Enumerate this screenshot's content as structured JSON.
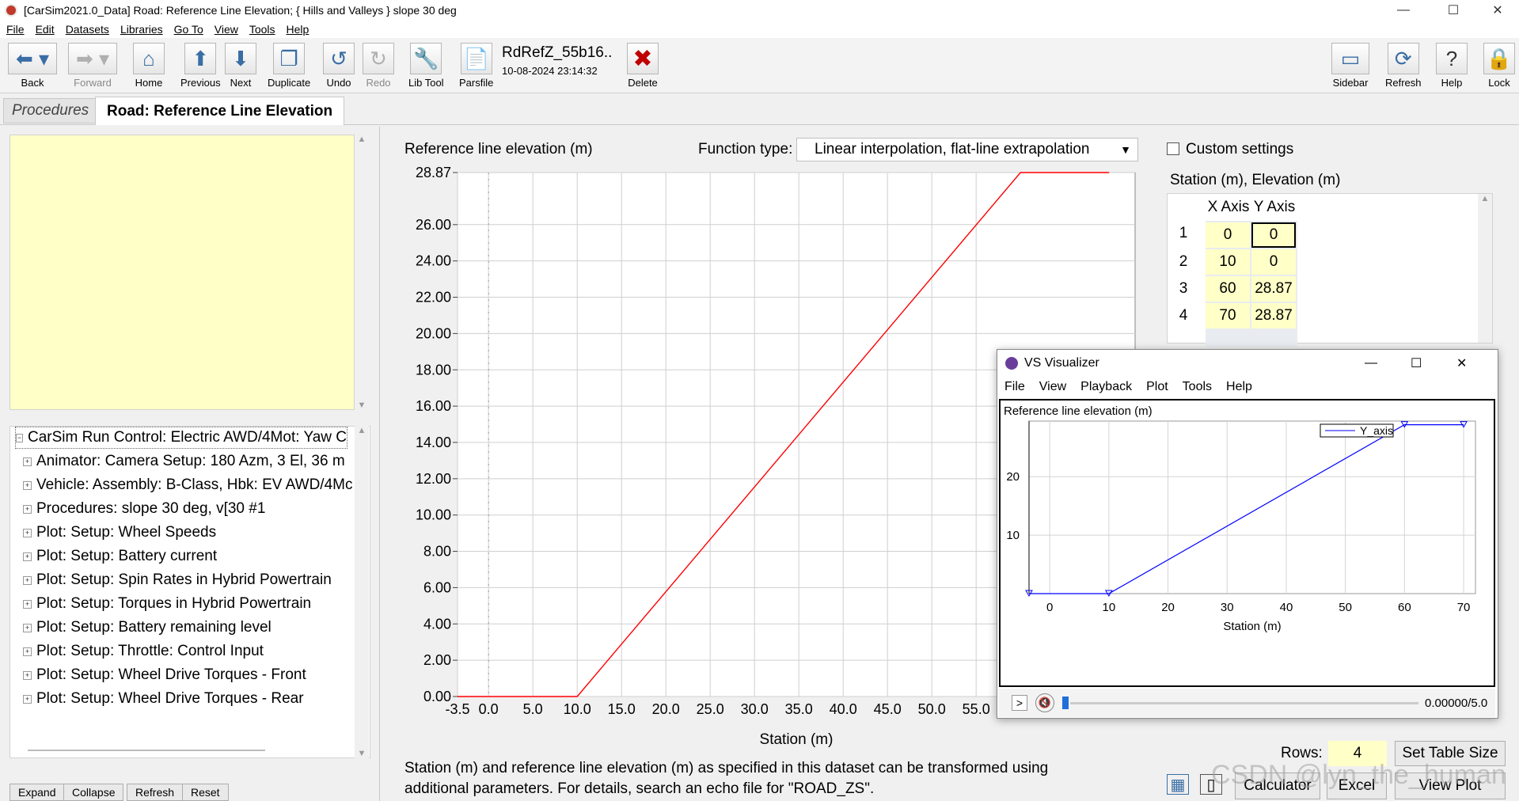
{
  "window": {
    "title": "[CarSim2021.0_Data] Road: Reference Line Elevation; { Hills and Valleys } slope 30 deg"
  },
  "menu": [
    "File",
    "Edit",
    "Datasets",
    "Libraries",
    "Go To",
    "View",
    "Tools",
    "Help"
  ],
  "toolbar": {
    "back": "Back",
    "forward": "Forward",
    "home": "Home",
    "previous": "Previous",
    "next": "Next",
    "duplicate": "Duplicate",
    "undo": "Undo",
    "redo": "Redo",
    "libtool": "Lib Tool",
    "parsfile": "Parsfile",
    "dataset_name": "RdRefZ_55b16..",
    "dataset_date": "10-08-2024 23:14:32",
    "delete": "Delete",
    "sidebar": "Sidebar",
    "refresh": "Refresh",
    "help": "Help",
    "lock": "Lock"
  },
  "tabs": {
    "procedures": "Procedures",
    "current": "Road: Reference Line Elevation"
  },
  "tree": {
    "items": [
      "CarSim Run Control: Electric AWD/4Mot: Yaw C",
      "Animator: Camera Setup: 180 Azm, 3 El, 36 m",
      "Vehicle: Assembly: B-Class, Hbk: EV AWD/4Mc",
      "Procedures: slope 30 deg, v[30 #1",
      "Plot: Setup: Wheel Speeds",
      "Plot: Setup: Battery current",
      "Plot: Setup: Spin Rates in Hybrid Powertrain",
      "Plot: Setup: Torques in Hybrid Powertrain",
      "Plot: Setup: Battery remaining level",
      "Plot: Setup: Throttle: Control Input",
      "Plot: Setup: Wheel Drive Torques - Front",
      "Plot: Setup: Wheel Drive Torques - Rear"
    ],
    "buttons": {
      "expand": "Expand",
      "collapse": "Collapse",
      "refresh": "Refresh",
      "reset": "Reset"
    }
  },
  "main": {
    "plot_title": "Reference line elevation (m)",
    "function_label": "Function type:",
    "function_value": "Linear interpolation, flat-line extrapolation",
    "custom_settings": "Custom settings",
    "table_title": "Station (m), Elevation (m)",
    "table_cols": [
      "X Axis",
      "Y Axis"
    ],
    "table_rows": [
      [
        "1",
        "0",
        "0"
      ],
      [
        "2",
        "10",
        "0"
      ],
      [
        "3",
        "60",
        "28.87"
      ],
      [
        "4",
        "70",
        "28.87"
      ]
    ],
    "description": "Station (m) and reference line elevation (m) as specified in this dataset can be transformed using additional parameters. For details, search an echo file for \"ROAD_ZS\".",
    "rows_label": "Rows:",
    "rows_value": "4",
    "set_table_size": "Set Table Size",
    "calculator": "Calculator",
    "excel": "Excel",
    "view_plot": "View Plot",
    "watermark": "CSDN @lyn_the_human"
  },
  "chart_data": [
    {
      "type": "line",
      "title": "",
      "xlabel": "Station (m)",
      "ylabel": "Reference line elevation (m)",
      "x": [
        -3.5,
        10,
        60,
        70
      ],
      "y": [
        0,
        0,
        28.87,
        28.87
      ],
      "xlim": [
        -3.5,
        70
      ],
      "ylim": [
        0,
        28.87
      ],
      "x_ticks": [
        "-3.5",
        "0.0",
        "5.0",
        "10.0",
        "15.0",
        "20.0",
        "25.0",
        "30.0",
        "35.0",
        "40.0",
        "45.0",
        "50.0",
        "55.0"
      ],
      "y_ticks": [
        "0.00",
        "2.00",
        "4.00",
        "6.00",
        "8.00",
        "10.00",
        "12.00",
        "14.00",
        "16.00",
        "18.00",
        "20.00",
        "22.00",
        "24.00",
        "26.00",
        "28.87"
      ],
      "color": "#ff0000",
      "grid": true
    },
    {
      "type": "line",
      "title": "Reference line elevation (m)",
      "xlabel": "Station (m)",
      "x": [
        -3.5,
        10,
        60,
        70
      ],
      "y": [
        0,
        0,
        28.87,
        28.87
      ],
      "xlim": [
        -3.5,
        72
      ],
      "ylim": [
        0,
        29.5
      ],
      "x_ticks": [
        "0",
        "10",
        "20",
        "30",
        "40",
        "50",
        "60",
        "70"
      ],
      "y_ticks": [
        "10",
        "20"
      ],
      "legend": "Y_axis",
      "legend_position": "top-right",
      "color": "#0000ff",
      "grid": true
    }
  ],
  "visualizer": {
    "title": "VS Visualizer",
    "menu": [
      "File",
      "View",
      "Playback",
      "Plot",
      "Tools",
      "Help"
    ],
    "play_label": ">",
    "time": "0.00000/5.0"
  }
}
